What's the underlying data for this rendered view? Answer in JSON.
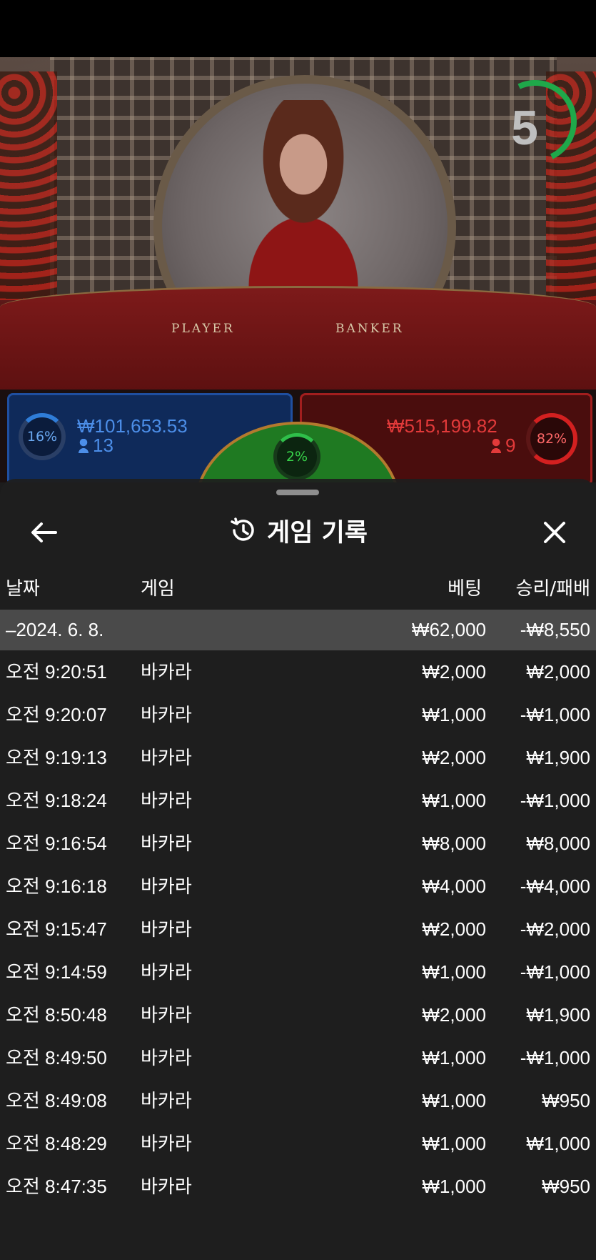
{
  "timer": {
    "countdown": "5"
  },
  "table": {
    "player_label": "PLAYER",
    "banker_label": "BANKER"
  },
  "bets": {
    "player": {
      "percent": "16%",
      "amount": "₩101,653.53",
      "players": "13"
    },
    "tie": {
      "percent": "2%"
    },
    "banker": {
      "percent": "82%",
      "amount": "₩515,199.82",
      "players": "9"
    }
  },
  "history": {
    "title": "게임 기록",
    "columns": {
      "date": "날짜",
      "game": "게임",
      "bet": "베팅",
      "result": "승리/패배"
    },
    "summary": {
      "date": "–2024. 6. 8.",
      "bet": "₩62,000",
      "result": "-₩8,550"
    },
    "rows": [
      {
        "time": "오전 9:20:51",
        "game": "바카라",
        "bet": "₩2,000",
        "result": "₩2,000"
      },
      {
        "time": "오전 9:20:07",
        "game": "바카라",
        "bet": "₩1,000",
        "result": "-₩1,000"
      },
      {
        "time": "오전 9:19:13",
        "game": "바카라",
        "bet": "₩2,000",
        "result": "₩1,900"
      },
      {
        "time": "오전 9:18:24",
        "game": "바카라",
        "bet": "₩1,000",
        "result": "-₩1,000"
      },
      {
        "time": "오전 9:16:54",
        "game": "바카라",
        "bet": "₩8,000",
        "result": "₩8,000"
      },
      {
        "time": "오전 9:16:18",
        "game": "바카라",
        "bet": "₩4,000",
        "result": "-₩4,000"
      },
      {
        "time": "오전 9:15:47",
        "game": "바카라",
        "bet": "₩2,000",
        "result": "-₩2,000"
      },
      {
        "time": "오전 9:14:59",
        "game": "바카라",
        "bet": "₩1,000",
        "result": "-₩1,000"
      },
      {
        "time": "오전 8:50:48",
        "game": "바카라",
        "bet": "₩2,000",
        "result": "₩1,900"
      },
      {
        "time": "오전 8:49:50",
        "game": "바카라",
        "bet": "₩1,000",
        "result": "-₩1,000"
      },
      {
        "time": "오전 8:49:08",
        "game": "바카라",
        "bet": "₩1,000",
        "result": "₩950"
      },
      {
        "time": "오전 8:48:29",
        "game": "바카라",
        "bet": "₩1,000",
        "result": "₩1,000"
      },
      {
        "time": "오전 8:47:35",
        "game": "바카라",
        "bet": "₩1,000",
        "result": "₩950"
      }
    ]
  },
  "colors": {
    "player": "#4c8ee8",
    "banker": "#e23a3a",
    "tie": "#38d24a",
    "timer": "#1fa84a"
  }
}
